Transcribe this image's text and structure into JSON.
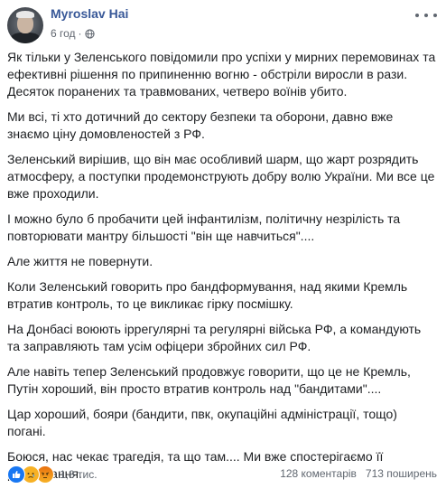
{
  "post": {
    "author": "Myroslav Hai",
    "time": "6 год",
    "paragraphs": [
      "Як тільки у Зеленського повідомили про успіхи у мирних перемовинах та ефективні рішення по припиненню вогню - обстріли виросли в рази. Десяток поранених та травмованих, четверо воїнів убито.",
      "Ми всі, ті хто дотичний до сектору безпеки та оборони, давно вже знаємо ціну домовленостей з РФ.",
      "Зеленський вирішив, що він має особливий шарм, що жарт розрядить атмосферу, а поступки продемонструють добру волю України. Ми все це вже проходили.",
      "І можно було б пробачити цей інфантилізм, політичну незрілість та повторювати мантру більшості \"він ще навчиться\"....",
      "Але життя не повернути.",
      "Коли Зеленський говорить про бандформування, над якими Кремль втратив контроль, то це викликає гірку посмішку.",
      "На Донбасі воюють іррегулярні та регулярні війська РФ, а командують та заправляють там усім офіцери збройних сил РФ.",
      "Але навіть тепер Зеленський продовжує говорити, що це не Кремль, Путін хороший, він просто втратив контроль над \"бандитами\"....",
      "Цар хороший, бояри (бандити, пвк, окупаційні адміністрації, тощо) погані.",
      "Боюся, нас чекає трагедія, та що там.... Ми вже спостерігаємо її розгортання."
    ]
  },
  "stats": {
    "reactions_count": "1,8 тис.",
    "comments": "128 коментарів",
    "shares": "713 поширень"
  },
  "colors": {
    "author_link": "#385898",
    "meta_text": "#616770",
    "like_blue": "#1877f2"
  },
  "icons": [
    "globe-icon",
    "more-options-icon",
    "like-reaction-icon",
    "sad-reaction-icon",
    "angry-reaction-icon"
  ]
}
